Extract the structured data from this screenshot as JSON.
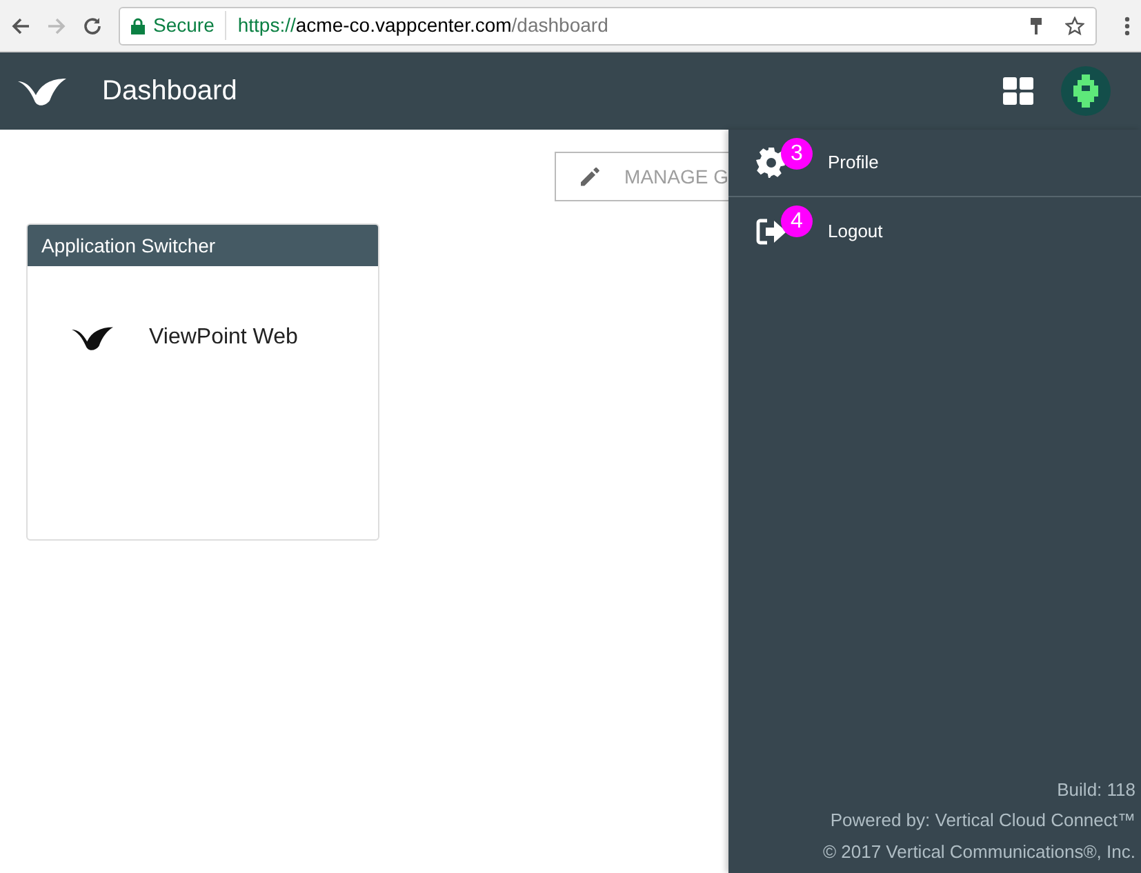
{
  "browser": {
    "secure_label": "Secure",
    "url_scheme": "https://",
    "url_host": "acme-co.vappcenter.com",
    "url_path": "/dashboard"
  },
  "header": {
    "title": "Dashboard"
  },
  "manage_button": {
    "label": "MANAGE G"
  },
  "widget": {
    "title": "Application Switcher",
    "apps": [
      {
        "label": "ViewPoint Web"
      }
    ]
  },
  "menu": {
    "items": [
      {
        "kind": "profile",
        "label": "Profile",
        "callout": "3"
      },
      {
        "kind": "logout",
        "label": "Logout",
        "callout": "4"
      }
    ],
    "footer": [
      "Build: 118",
      "Powered by: Vertical Cloud Connect™",
      "© 2017 Vertical Communications®, Inc."
    ]
  }
}
